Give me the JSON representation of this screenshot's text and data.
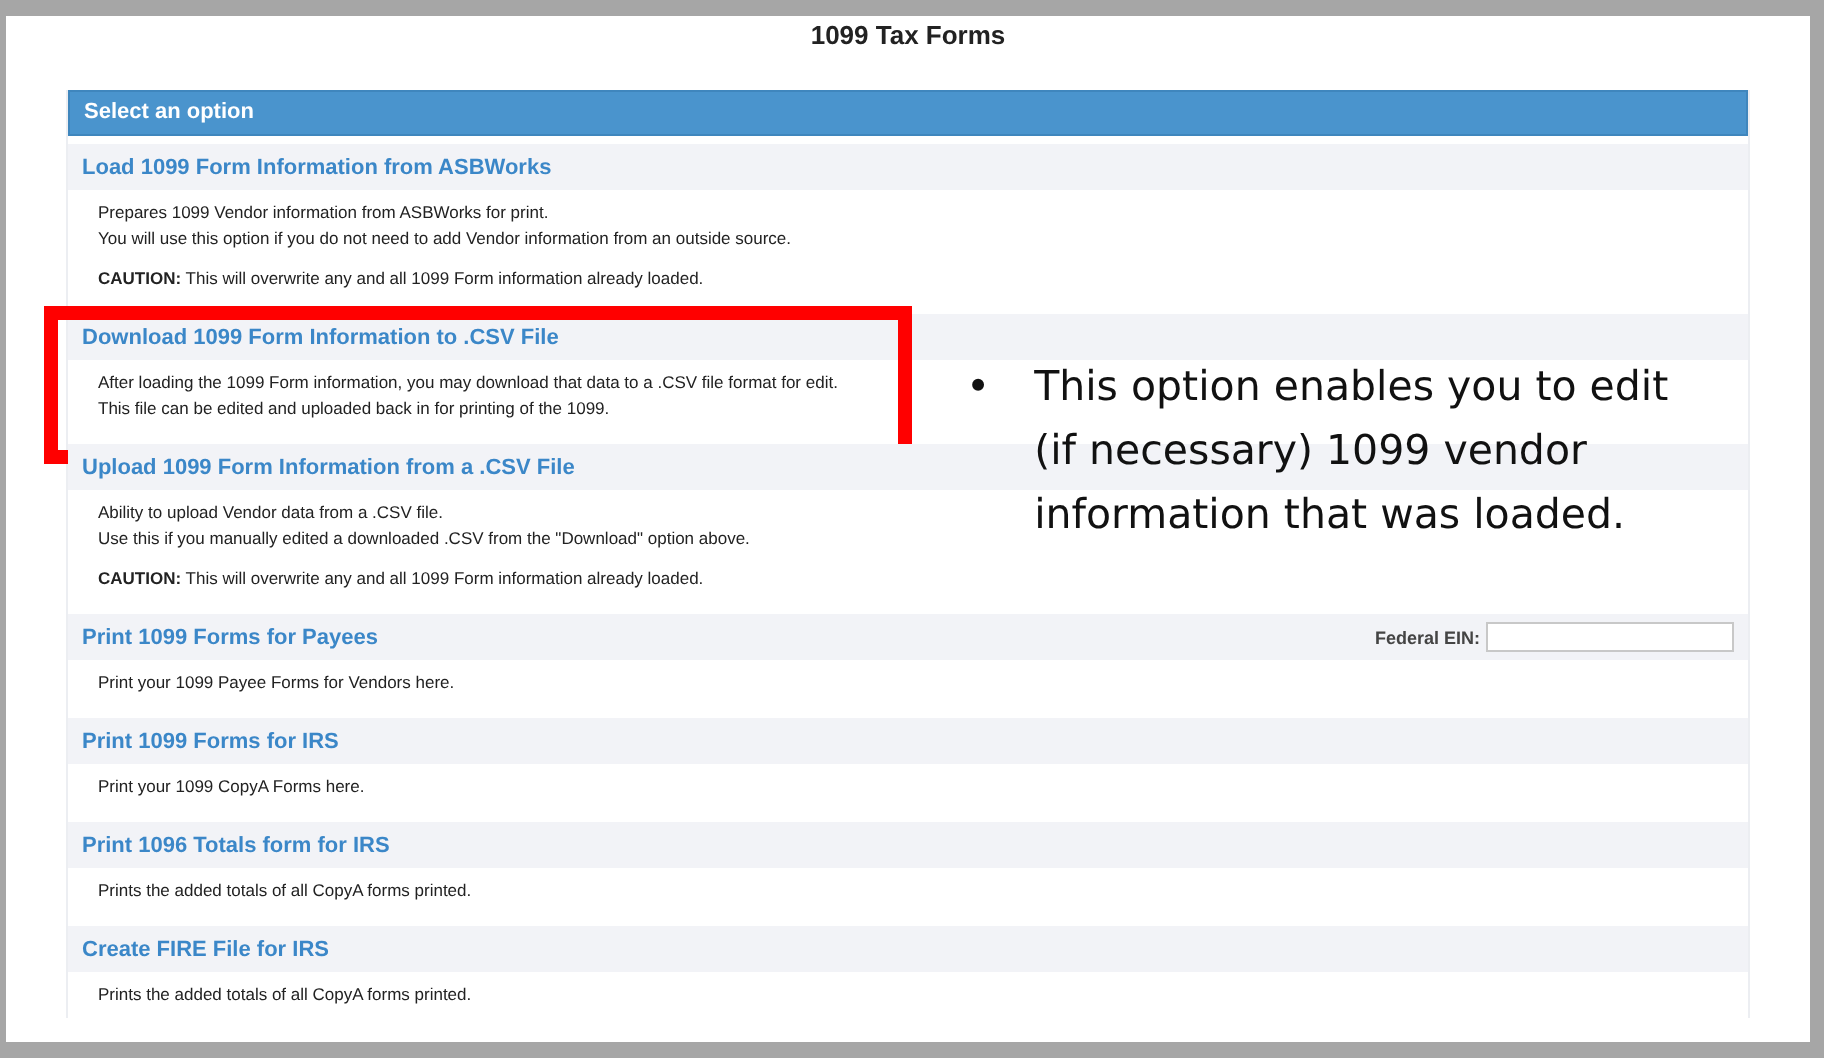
{
  "page_title": "1099 Tax Forms",
  "panel": {
    "header": "Select an option",
    "sections": [
      {
        "title": "Load 1099 Form Information from ASBWorks",
        "lines": [
          "Prepares 1099 Vendor information from ASBWorks for print.",
          "You will use this option if you do not need to add Vendor information from an outside source."
        ],
        "note": "**CAUTION:** This will overwrite any and all 1099 Form information already loaded.",
        "highlighted": false
      },
      {
        "title": "Download 1099 Form Information to .CSV File",
        "lines": [
          "After loading the 1099 Form information, you may download that data to a .CSV file format for edit.",
          "This file can be edited and uploaded back in for printing of the 1099."
        ],
        "highlighted": true
      },
      {
        "title": "Upload 1099 Form Information from a .CSV File",
        "lines": [
          "Ability to upload Vendor data from a .CSV file.",
          "Use this if you manually edited a downloaded .CSV from the \"Download\" option above."
        ],
        "note": "**CAUTION:** This will overwrite any and all 1099 Form information already loaded.",
        "highlighted": false
      },
      {
        "title": "Print 1099 Forms for Payees",
        "lines": [
          "Print your 1099 Payee Forms for Vendors here."
        ],
        "field": {
          "label": "Federal EIN:"
        },
        "highlighted": false
      },
      {
        "title": "Print 1099 Forms for IRS",
        "lines": [
          "Print your 1099 CopyA Forms here."
        ],
        "highlighted": false
      },
      {
        "title": "Print 1096 Totals form for IRS",
        "lines": [
          "Prints the added totals of all CopyA forms printed."
        ],
        "highlighted": false
      },
      {
        "title": "Create FIRE File for IRS",
        "lines": [
          "Prints the added totals of all CopyA forms printed."
        ],
        "highlighted": false
      }
    ]
  },
  "callout": {
    "bullet": "•",
    "text": "This option enables you to edit (if necessary) 1099 vendor information that was loaded."
  }
}
